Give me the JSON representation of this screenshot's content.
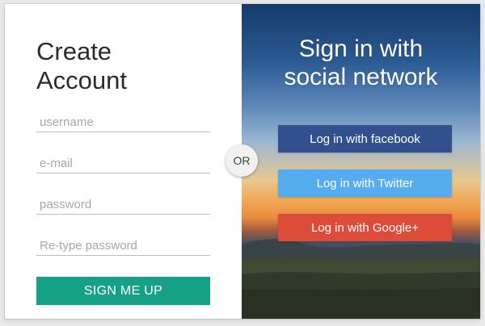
{
  "colors": {
    "primary": "#16a085",
    "facebook": "#32508e",
    "twitter": "#55acee",
    "google": "#dd4b39"
  },
  "left": {
    "title": "Create\nAccount",
    "fields": {
      "username": {
        "placeholder": "username",
        "value": ""
      },
      "email": {
        "placeholder": "e-mail",
        "value": ""
      },
      "password": {
        "placeholder": "password",
        "value": ""
      },
      "retype": {
        "placeholder": "Re-type password",
        "value": ""
      }
    },
    "signup_label": "SIGN ME UP"
  },
  "divider": {
    "label": "OR"
  },
  "right": {
    "title": "Sign in with\nsocial network",
    "buttons": {
      "facebook": "Log in with facebook",
      "twitter": "Log in with Twitter",
      "google": "Log in with Google+"
    }
  }
}
